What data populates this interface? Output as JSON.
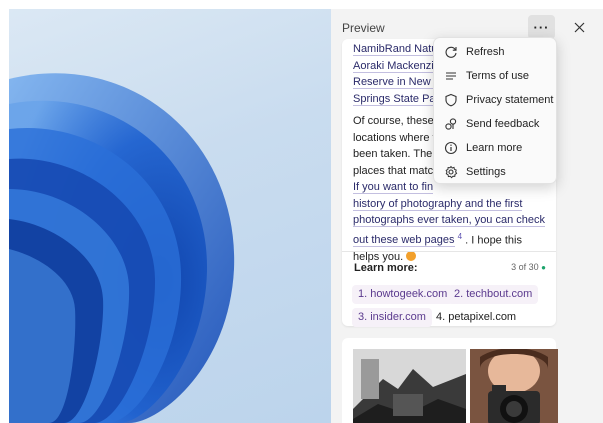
{
  "panel": {
    "title": "Preview",
    "more_label": "···",
    "close_label": "✕"
  },
  "article": {
    "top_lines": [
      "NamibRand Natu",
      "Aoraki Mackenzie",
      "Reserve in New Z",
      "Springs State Par"
    ],
    "para_lines": [
      "Of course, these a",
      "locations where t",
      "been taken. There",
      "places that match"
    ],
    "link_lines": [
      "If you want to fin",
      "history of photography and the first",
      "photographs ever taken, you can check",
      "out these web pages"
    ],
    "citation": "4",
    "tail": " . I hope this",
    "last_line": "helps you."
  },
  "learn_more": {
    "title": "Learn more:",
    "count": "3 of 30",
    "sources": [
      "1. howtogeek.com",
      "2. techbout.com",
      "3. insider.com",
      "4. petapixel.com"
    ]
  },
  "menu": {
    "items": [
      {
        "label": "Refresh",
        "icon": "refresh-icon"
      },
      {
        "label": "Terms of use",
        "icon": "list-icon"
      },
      {
        "label": "Privacy statement",
        "icon": "shield-icon"
      },
      {
        "label": "Send feedback",
        "icon": "feedback-icon"
      },
      {
        "label": "Learn more",
        "icon": "info-icon"
      },
      {
        "label": "Settings",
        "icon": "gear-icon"
      }
    ]
  },
  "colors": {
    "link_text": "#2b2b6a",
    "chip_text": "#5b3a8e",
    "accent_dot": "#1ca36b",
    "wallpaper_blue": "#1f5fc6"
  }
}
